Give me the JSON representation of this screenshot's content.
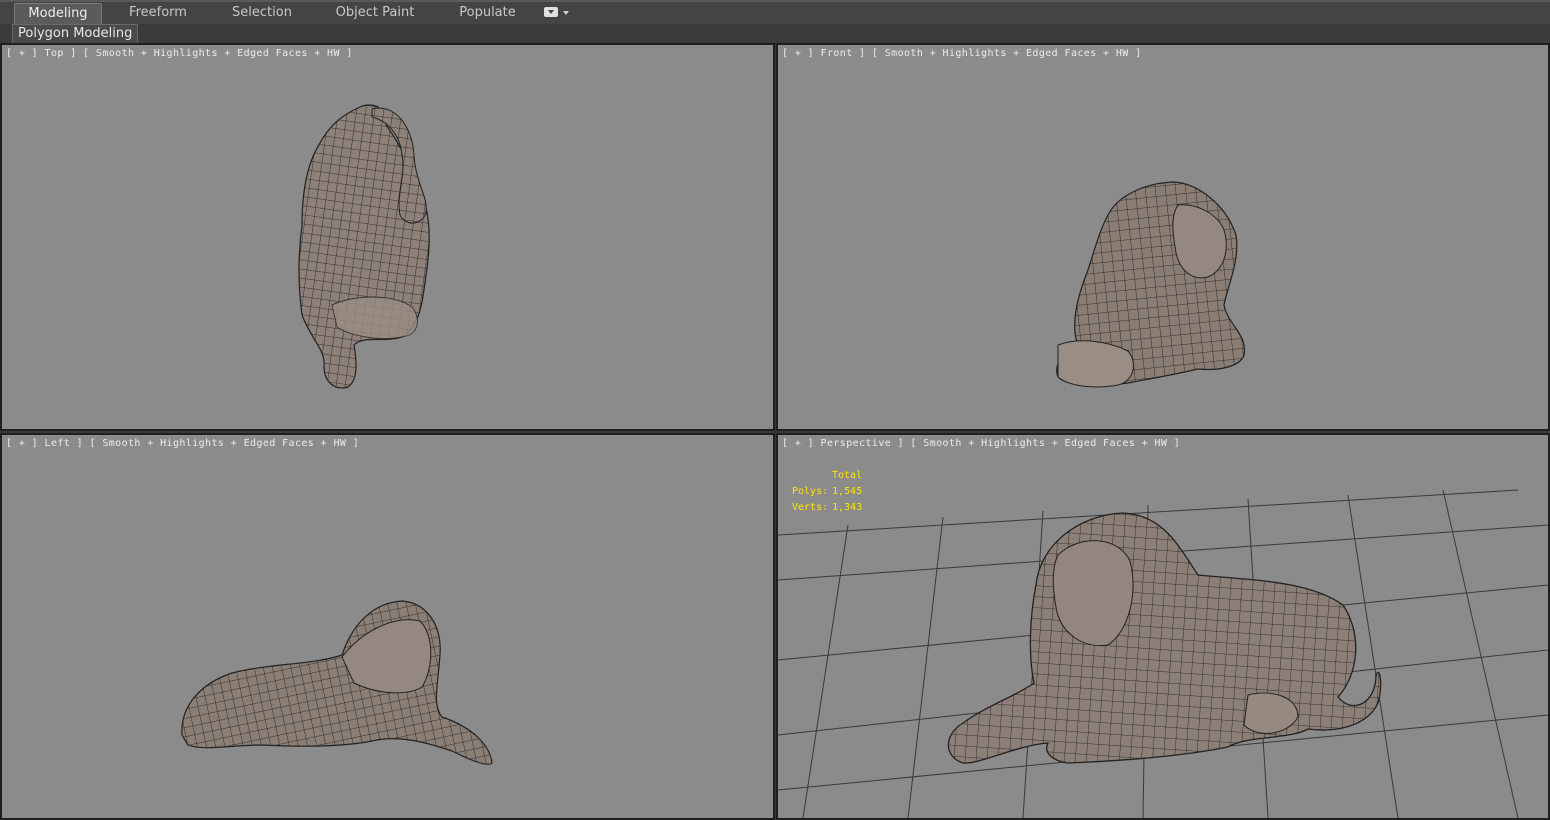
{
  "ribbon": {
    "tabs": [
      "Modeling",
      "Freeform",
      "Selection",
      "Object Paint",
      "Populate"
    ],
    "active_tab": "Modeling",
    "panel_label": "Polygon Modeling",
    "toggle_icon": "ribbon-minimize-icon"
  },
  "viewports": {
    "top": {
      "open": "[ + ]",
      "view": "Top",
      "shading": "Smooth + Highlights + Edged Faces + HW",
      "close": "]"
    },
    "front": {
      "open": "[ + ]",
      "view": "Front",
      "shading": "Smooth + Highlights + Edged Faces + HW",
      "close": "]"
    },
    "left": {
      "open": "[ + ]",
      "view": "Left",
      "shading": "Smooth + Highlights + Edged Faces + HW",
      "close": "]"
    },
    "perspective": {
      "open": "[ + ]",
      "view": "Perspective",
      "shading": "Smooth + Highlights + Edged Faces + HW",
      "close": "]"
    }
  },
  "stats": {
    "total_label": "Total",
    "polys_label": "Polys:",
    "polys_value": "1,545",
    "verts_label": "Verts:",
    "verts_value": "1,343"
  },
  "colors": {
    "viewport_bg": "#8b8b8b",
    "stats_text": "#ffe600",
    "mesh_fill": "#8c7f76",
    "mesh_wire": "#1a1a1a"
  }
}
